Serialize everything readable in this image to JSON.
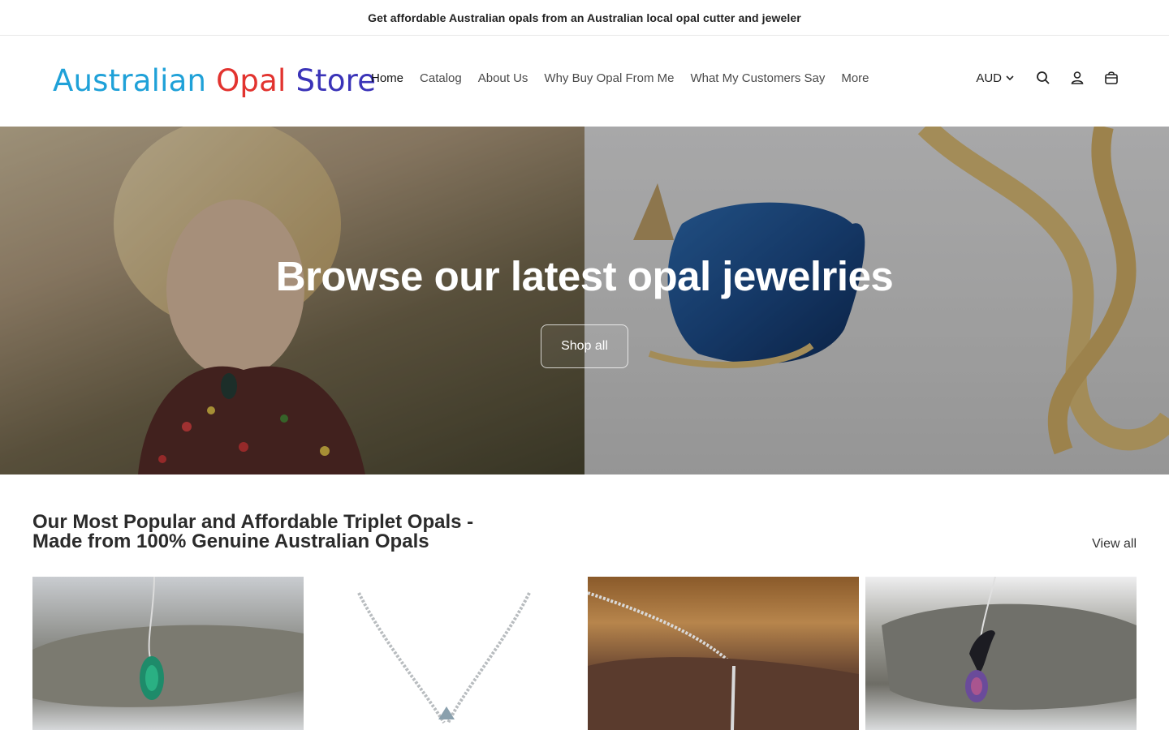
{
  "announcement": {
    "text": "Get affordable Australian opals from an Australian local opal cutter and jeweler"
  },
  "header": {
    "logo": {
      "word1": "Australian",
      "word2": "Opal",
      "word3": "Store"
    },
    "nav": [
      {
        "label": "Home",
        "active": true
      },
      {
        "label": "Catalog"
      },
      {
        "label": "About Us"
      },
      {
        "label": "Why Buy Opal From Me"
      },
      {
        "label": "What My Customers Say"
      },
      {
        "label": "More"
      }
    ],
    "currency": "AUD",
    "icons": [
      "search-icon",
      "account-icon",
      "cart-icon"
    ]
  },
  "hero": {
    "title": "Browse our latest opal jewelries",
    "button_label": "Shop all"
  },
  "featured": {
    "title": "Our Most Popular and Affordable Triplet Opals - Made from 100% Genuine Australian Opals",
    "view_all": "View all"
  },
  "colors": {
    "logo_blue": "#1fa1d8",
    "logo_red": "#e2332f",
    "logo_indigo": "#3a33b8",
    "text": "#121212"
  }
}
